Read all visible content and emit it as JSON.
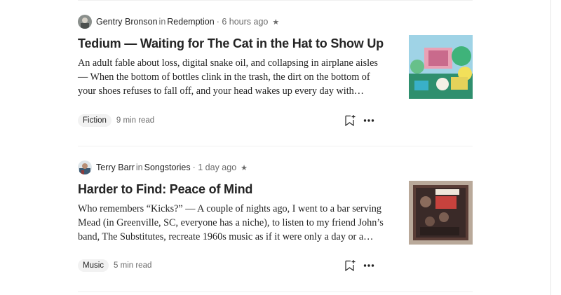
{
  "articles": [
    {
      "author": "Gentry Bronson",
      "in_word": "in",
      "publication": "Redemption",
      "time": "· 6 hours ago",
      "star": "★",
      "title": "Tedium — Waiting for The Cat in the Hat to Show Up",
      "excerpt_lines": [
        "An adult fable about loss, digital snake oil, and collapsing in airplane aisles",
        "— When the bottom of bottles clink in the trash, the dirt on the bottom of",
        "your shoes refuses to fall off, and your head wakes up every day with…"
      ],
      "tag": "Fiction",
      "read_time": "9 min read"
    },
    {
      "author": "Terry Barr",
      "in_word": "in",
      "publication": "Songstories",
      "time": "· 1 day ago",
      "star": "★",
      "title": "Harder to Find: Peace of Mind",
      "excerpt_lines": [
        "Who remembers “Kicks?” — A couple of nights ago, I went to a bar serving",
        "Mead (in Greenville, SC, everyone has a niche), to listen to my friend John’s",
        "band, The Substitutes, recreate 1960s music as if it were only a day or a…"
      ],
      "tag": "Music",
      "read_time": "5 min read"
    }
  ],
  "icons": {
    "save": "bookmark-plus-icon",
    "more": "more-horizontal-icon"
  },
  "colors": {
    "text": "#242424",
    "muted": "#6b6b6b",
    "tag_bg": "#f2f2f2",
    "divider": "#f0f0f0"
  }
}
